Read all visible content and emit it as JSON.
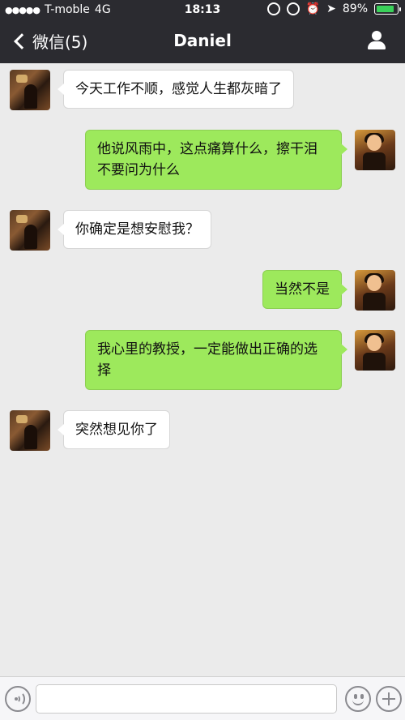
{
  "status_bar": {
    "signal_dots": "●●●●●",
    "carrier": "T-moble",
    "network": "4G",
    "time": "18:13",
    "battery_percent": "89%",
    "battery_level": 0.89
  },
  "nav": {
    "back_label": "微信(5)",
    "title": "Daniel"
  },
  "messages": [
    {
      "side": "in",
      "text": "今天工作不顺，感觉人生都灰暗了"
    },
    {
      "side": "out",
      "text": "他说风雨中，这点痛算什么，擦干泪不要问为什么"
    },
    {
      "side": "in",
      "text": "你确定是想安慰我？"
    },
    {
      "side": "out",
      "text": "当然不是"
    },
    {
      "side": "out",
      "text": "我心里的教授，一定能做出正确的选择"
    },
    {
      "side": "in",
      "text": "突然想见你了"
    }
  ],
  "composer": {
    "value": "",
    "icons": [
      "voice-icon",
      "emoji-icon",
      "plus-icon"
    ]
  },
  "colors": {
    "header_bg": "#2b2b30",
    "chat_bg": "#ebebeb",
    "outgoing_bubble": "#9de95c",
    "incoming_bubble": "#ffffff"
  }
}
